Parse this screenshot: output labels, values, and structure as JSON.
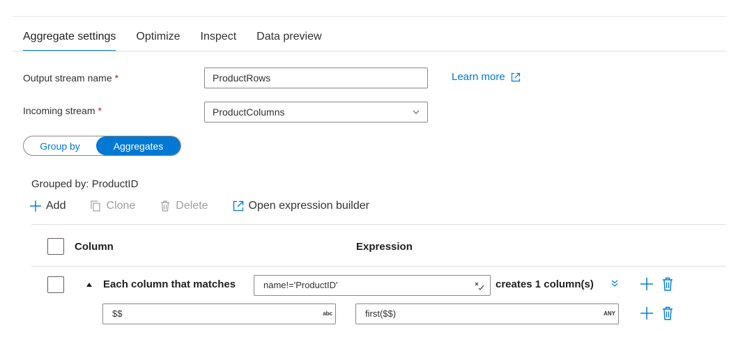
{
  "tabs": [
    {
      "label": "Aggregate settings",
      "active": true
    },
    {
      "label": "Optimize",
      "active": false
    },
    {
      "label": "Inspect",
      "active": false
    },
    {
      "label": "Data preview",
      "active": false
    }
  ],
  "form": {
    "output_stream": {
      "label": "Output stream name",
      "required_mark": "*",
      "value": "ProductRows"
    },
    "incoming_stream": {
      "label": "Incoming stream",
      "required_mark": "*",
      "value": "ProductColumns"
    },
    "learn_more": "Learn more"
  },
  "toggle": {
    "group_by": "Group by",
    "aggregates": "Aggregates",
    "selected": "Aggregates"
  },
  "grouped_by": "Grouped by: ProductID",
  "toolbar": {
    "add": "Add",
    "clone": "Clone",
    "delete": "Delete",
    "open_expression_builder": "Open expression builder"
  },
  "table": {
    "headers": {
      "column": "Column",
      "expression": "Expression"
    },
    "pattern_row": {
      "label": "Each column that matches",
      "match_expression": "name!='ProductID'",
      "creates_text": "creates 1 column(s)"
    },
    "sub_row": {
      "column_value": "$$",
      "column_type": "abc",
      "expression_value": "first($$)",
      "expression_type": "ANY"
    }
  },
  "colors": {
    "accent": "#0078d4",
    "border": "#8a8886",
    "text": "#323130",
    "disabled": "#a19f9d"
  }
}
